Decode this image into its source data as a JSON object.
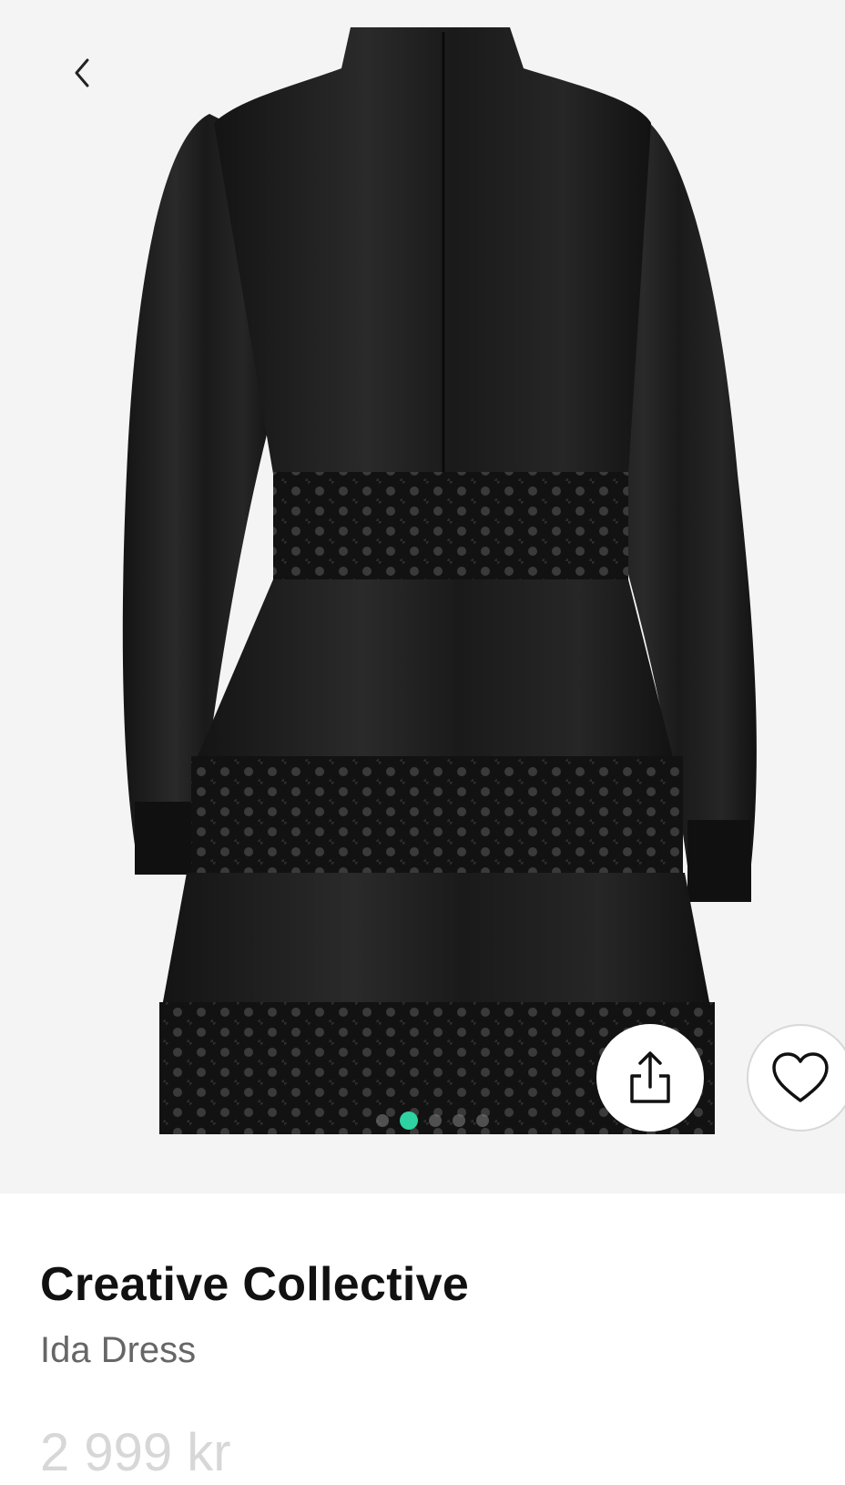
{
  "header": {
    "back_icon": "chevron-left-icon"
  },
  "gallery": {
    "image_alt": "Black satin mini dress with lace panels, back view",
    "dots_count": 5,
    "active_dot": 0,
    "accent": "#2ed2a3"
  },
  "actions": {
    "share_icon": "share-icon",
    "favorite_icon": "heart-icon"
  },
  "product": {
    "brand": "Creative Collective",
    "name": "Ida Dress",
    "price": "2 999 kr"
  }
}
